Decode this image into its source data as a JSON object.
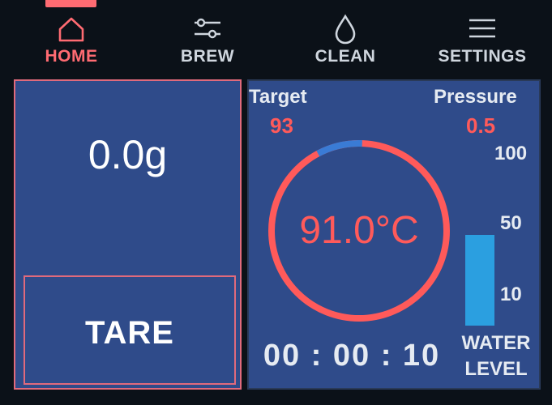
{
  "nav": {
    "items": [
      {
        "label": "HOME",
        "icon": "home-icon",
        "active": true
      },
      {
        "label": "BREW",
        "icon": "sliders-icon",
        "active": false
      },
      {
        "label": "CLEAN",
        "icon": "droplet-icon",
        "active": false
      },
      {
        "label": "SETTINGS",
        "icon": "menu-icon",
        "active": false
      }
    ]
  },
  "scale": {
    "weight": "0.0g",
    "tare_label": "TARE"
  },
  "brew": {
    "target_label": "Target",
    "target_value": "93",
    "pressure_label": "Pressure",
    "pressure_value": "0.5",
    "temperature": "91.0°C",
    "timer": "00 : 00 : 10",
    "ring_fraction": 0.98,
    "water": {
      "ticks": [
        "100",
        "50",
        "10"
      ],
      "level_fraction": 0.27,
      "label_line1": "WATER",
      "label_line2": "LEVEL"
    }
  },
  "colors": {
    "accent": "#ff6b72",
    "panel": "#2f4b8a",
    "temp_red": "#ff5a5a",
    "ring_blue": "#3a7bd5",
    "water": "#2b9fe0"
  }
}
